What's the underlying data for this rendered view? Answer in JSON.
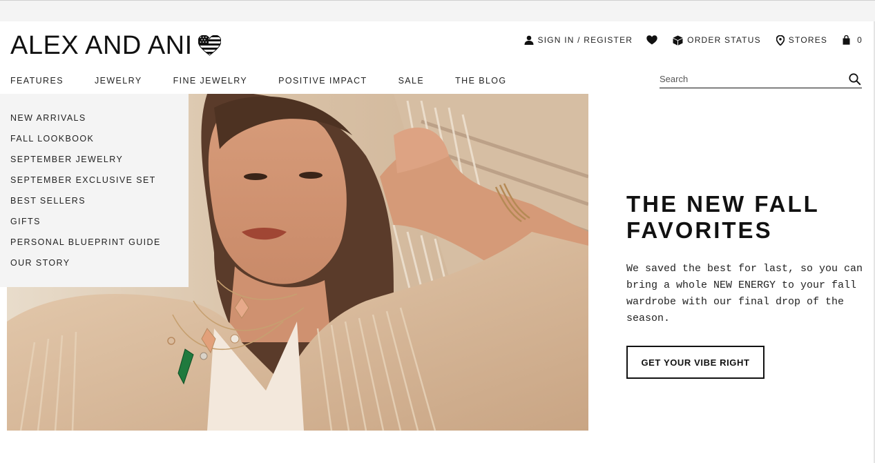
{
  "brand": {
    "name": "ALEX AND ANI"
  },
  "utility_nav": {
    "sign_in": "SIGN IN / REGISTER",
    "order_status": "ORDER STATUS",
    "stores": "STORES",
    "bag_count": "0"
  },
  "main_nav": [
    {
      "label": "FEATURES"
    },
    {
      "label": "JEWELRY"
    },
    {
      "label": "FINE JEWELRY"
    },
    {
      "label": "POSITIVE IMPACT"
    },
    {
      "label": "SALE"
    },
    {
      "label": "THE BLOG"
    }
  ],
  "search": {
    "placeholder": "Search"
  },
  "features_menu": [
    {
      "label": "NEW ARRIVALS"
    },
    {
      "label": "FALL LOOKBOOK"
    },
    {
      "label": "SEPTEMBER JEWELRY"
    },
    {
      "label": "SEPTEMBER EXCLUSIVE SET"
    },
    {
      "label": "BEST SELLERS"
    },
    {
      "label": "GIFTS"
    },
    {
      "label": "PERSONAL BLUEPRINT GUIDE"
    },
    {
      "label": "OUR STORY"
    }
  ],
  "hero": {
    "title_line1": "THE NEW FALL",
    "title_line2": "FAVORITES",
    "text": "We saved the best for last, so you can bring a whole NEW ENERGY to your fall wardrobe with our final drop of the season.",
    "cta": "GET YOUR VIBE RIGHT"
  },
  "colors": {
    "text": "#111111",
    "dropdown_bg": "#f4f4f4",
    "photo_tone": "#c9a88a"
  },
  "icons": {
    "logo_heart": "american-flag-heart-icon",
    "sign_in": "user-icon",
    "wishlist": "heart-icon",
    "order_status": "box-icon",
    "stores": "location-pin-icon",
    "bag": "shopping-bag-icon",
    "search": "search-icon"
  }
}
